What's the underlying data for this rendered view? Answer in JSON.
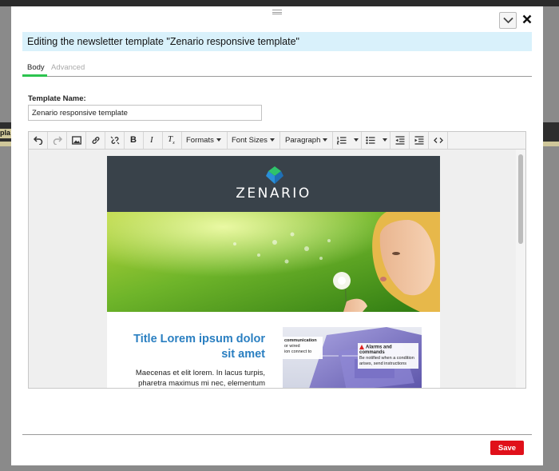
{
  "background": {
    "left_label": "pla"
  },
  "dialog": {
    "title": "Editing the newsletter template \"Zenario responsive template\"",
    "tabs": [
      {
        "label": "Body"
      },
      {
        "label": "Advanced"
      }
    ],
    "template_name_label": "Template Name:",
    "template_name_value": "Zenario responsive template",
    "save_label": "Save"
  },
  "toolbar": {
    "formats_label": "Formats",
    "font_sizes_label": "Font Sizes",
    "paragraph_label": "Paragraph"
  },
  "newsletter": {
    "brand": "ZENARIO",
    "title": "Title Lorem ipsum dolor sit amet",
    "body_line1": "Maecenas et elit lorem. In lacus turpis,",
    "body_line2": "pharetra maximus mi nec, elementum",
    "callout1_title": "communication",
    "callout1_line1": "or wired",
    "callout1_line2": "ion connect to",
    "callout2_title": "Alarms and commands",
    "callout2_line1": "Be notified when a condition",
    "callout2_line2": "arises, send instructions"
  },
  "colors": {
    "accent_green": "#2cc44f",
    "title_bar_bg": "#d9f1fb",
    "save_red": "#e0101a",
    "newsletter_header": "#39424a",
    "newsletter_title": "#2a7fc1"
  }
}
